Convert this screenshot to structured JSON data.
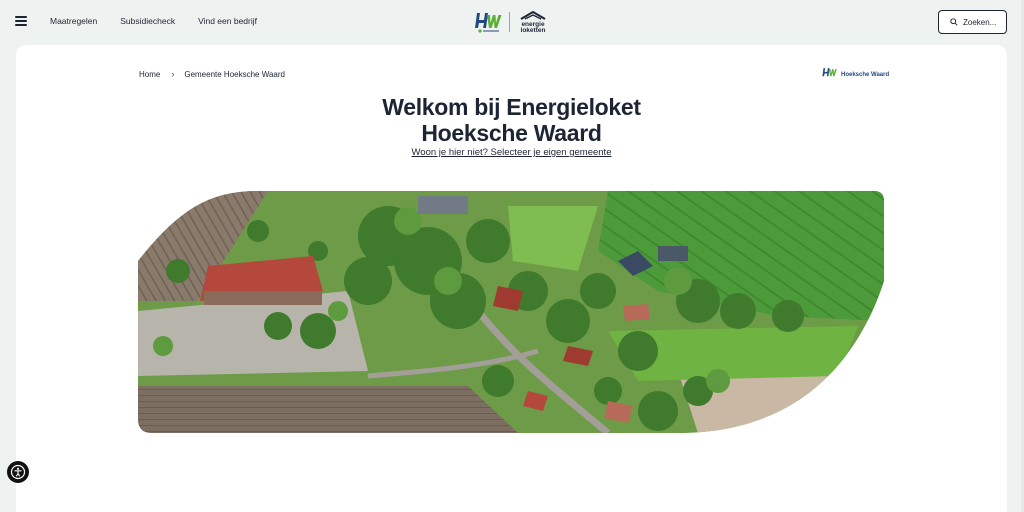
{
  "nav": {
    "items": [
      "Maatregelen",
      "Subsidiecheck",
      "Vind een bedrijf"
    ]
  },
  "brand": {
    "hw_logo_text": "HW",
    "energieloket_line1": "energie",
    "energieloket_line2": "loketten"
  },
  "search": {
    "label": "Zoeken..."
  },
  "breadcrumb": {
    "home": "Home",
    "current": "Gemeente Hoeksche Waard"
  },
  "municipality_logo": {
    "name": "Hoeksche Waard"
  },
  "hero": {
    "title_line1": "Welkom bij Energieloket",
    "title_line2": "Hoeksche Waard",
    "change_link": "Woon je hier niet? Selecteer je eigen gemeente"
  },
  "colors": {
    "background": "#eef3f1",
    "card": "#ffffff",
    "text": "#1d2433",
    "hw_green": "#5bb033",
    "hw_blue": "#234a7e"
  }
}
